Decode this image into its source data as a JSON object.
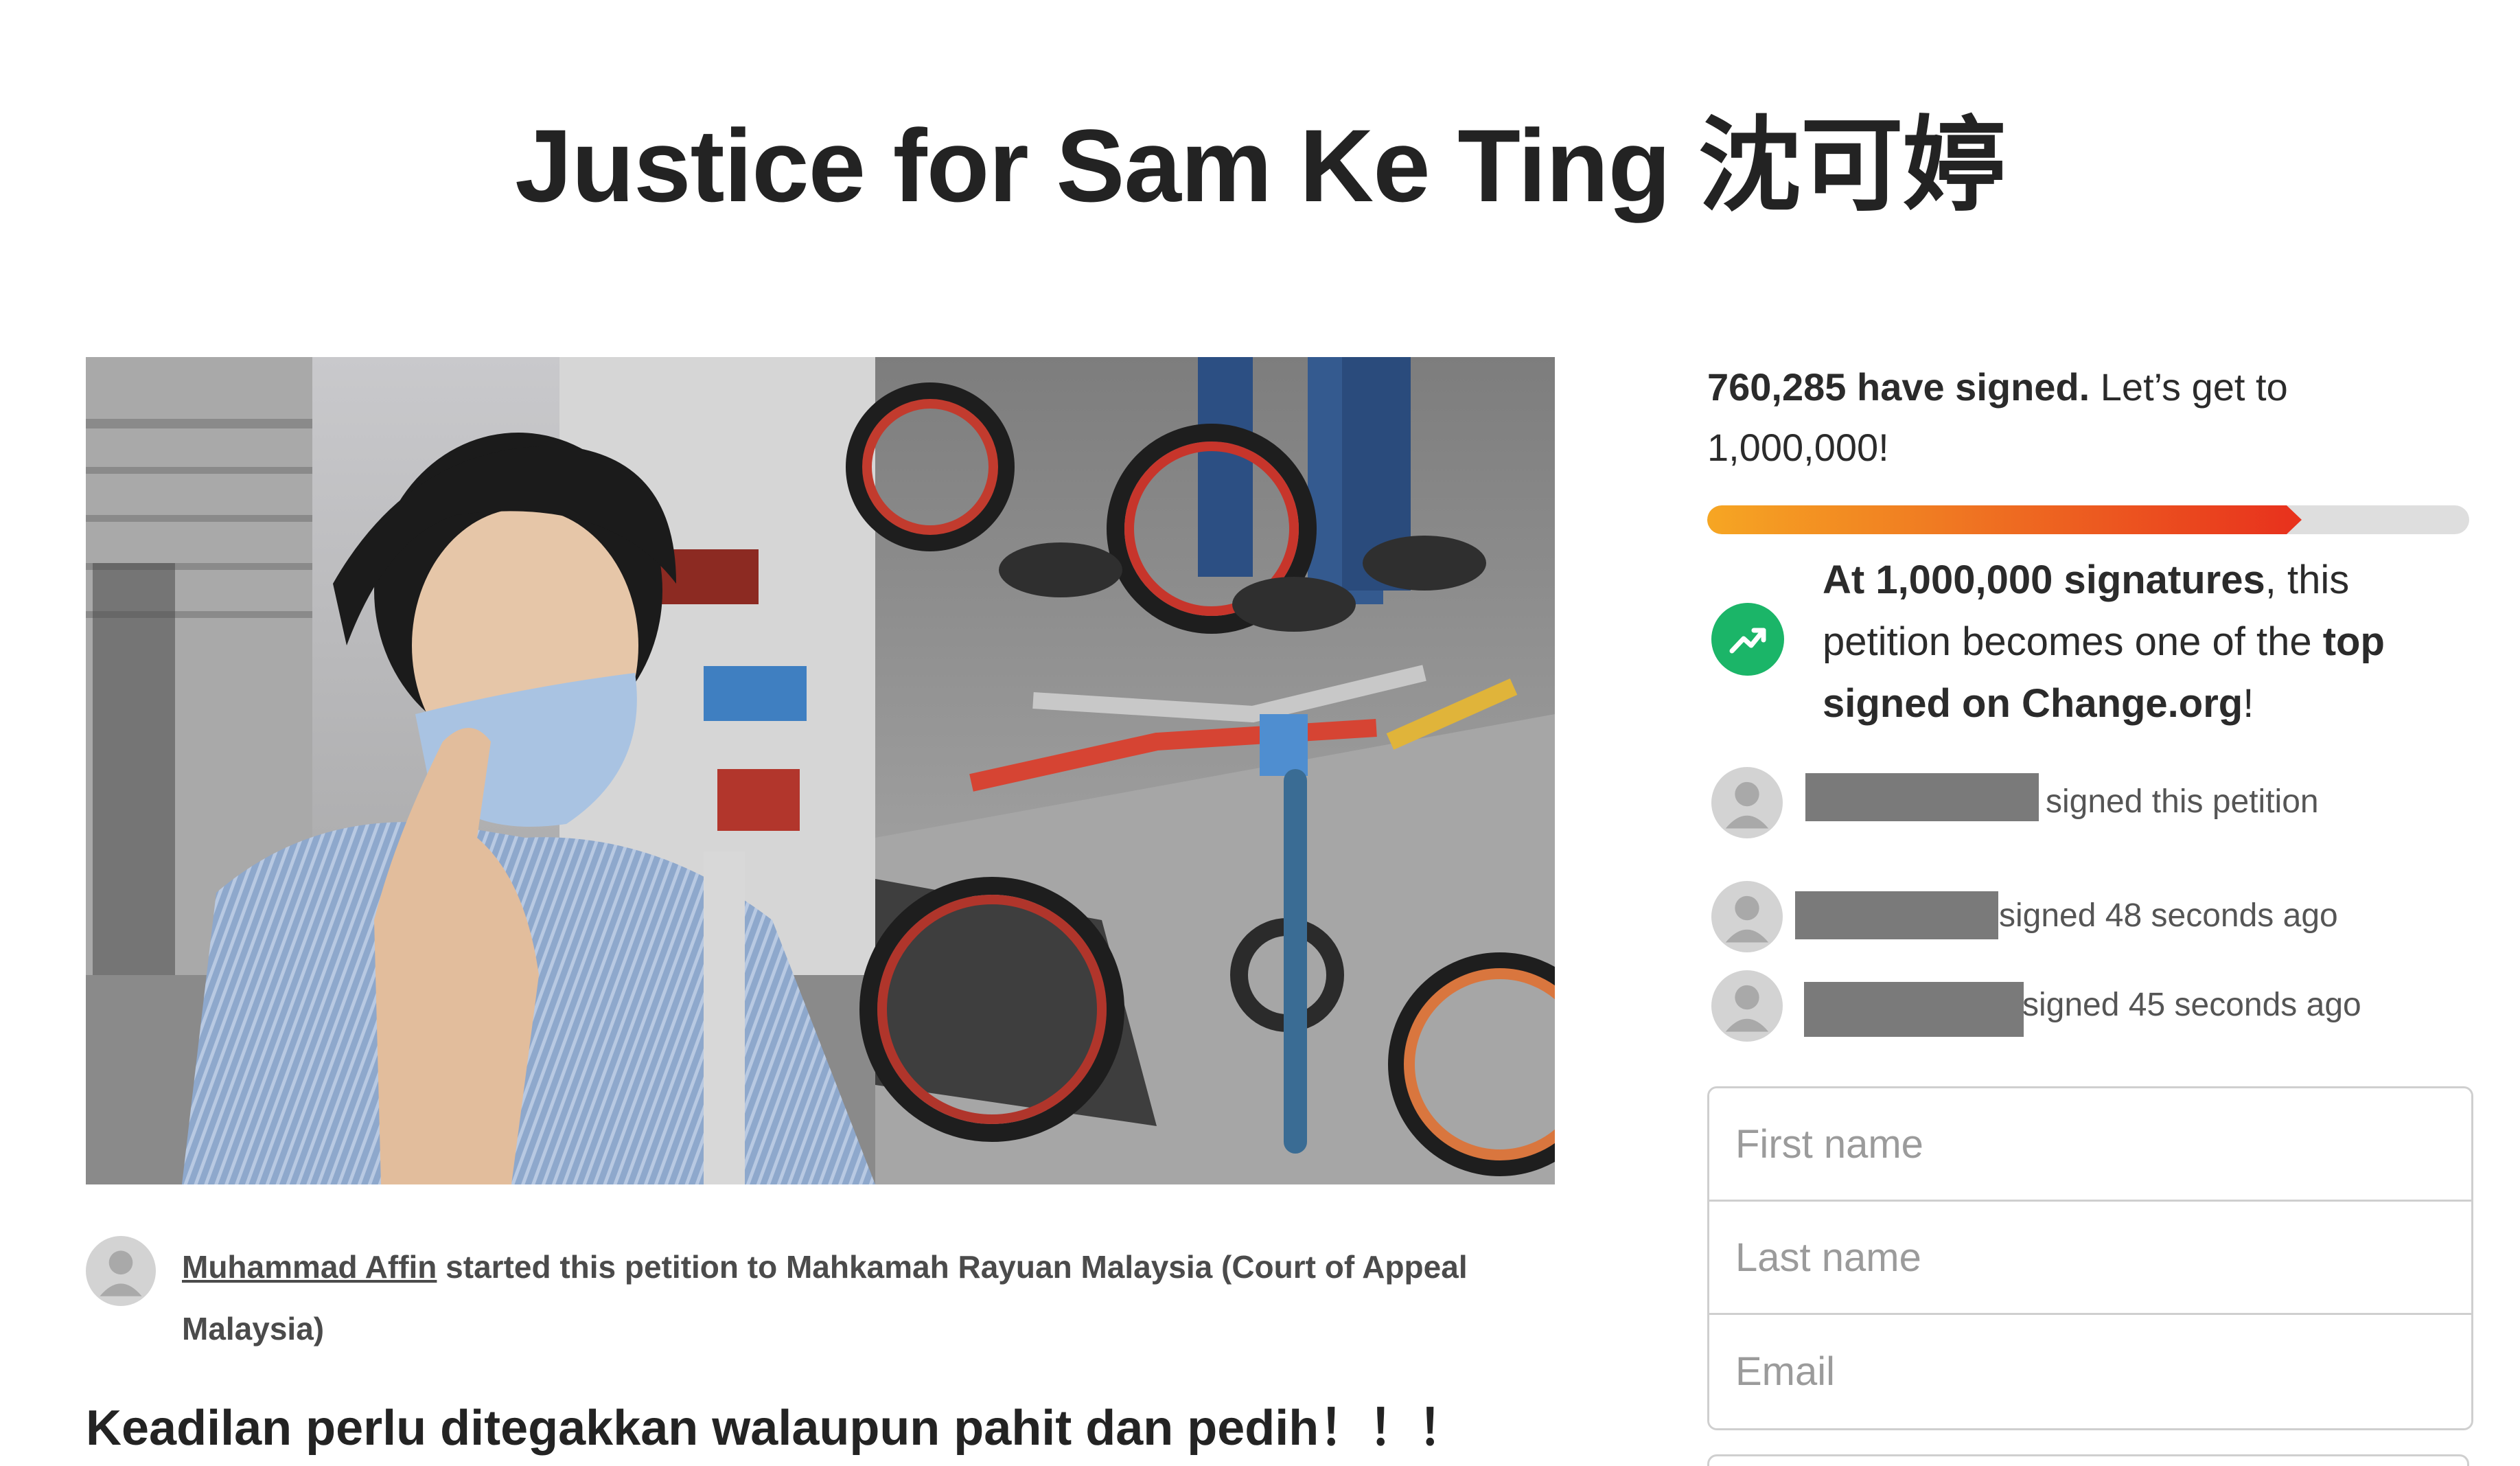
{
  "page": {
    "title": "Justice for Sam Ke Ting 沈可婷"
  },
  "petition": {
    "author": "Muhammad Affin",
    "started_text": " started this petition to Mahkamah Rayuan Malaysia (Court of Appeal Malaysia)",
    "headline": "Keadilan perlu ditegakkan walaupun pahit dan pedih！！！"
  },
  "progress": {
    "signed_count": "760,285 have signed.",
    "goal_text": " Let’s get to 1,000,000!",
    "signed_value": 760285,
    "goal_value": 1000000
  },
  "milestone": {
    "icon": "trending-up-icon",
    "bold_1": "At 1,000,000 signatures",
    "text_1": ", this petition becomes one of the ",
    "bold_2": "top signed on Change.org",
    "text_2": "!"
  },
  "recent_signers": [
    {
      "text": "signed this petition"
    },
    {
      "text": "signed 48 seconds ago"
    },
    {
      "text": "signed 45 seconds ago"
    }
  ],
  "form": {
    "first_name_placeholder": "First name",
    "last_name_placeholder": "Last name",
    "email_placeholder": "Email"
  },
  "colors": {
    "progress_start": "#f6a623",
    "progress_end": "#e8331d",
    "milestone_green": "#1bb568",
    "redaction": "#7a7a7a"
  }
}
